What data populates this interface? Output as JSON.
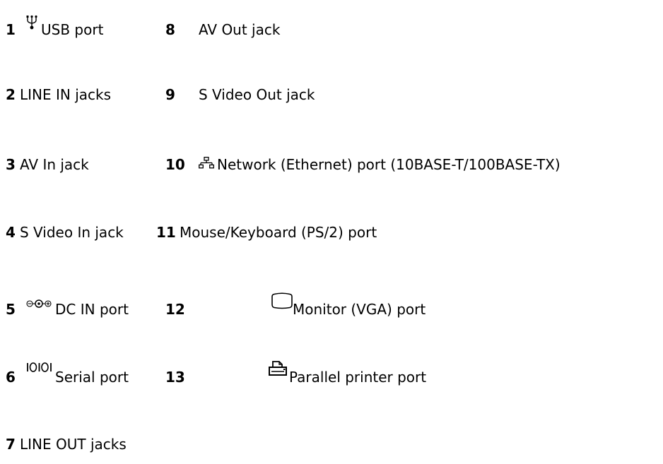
{
  "left_column": [
    {
      "num": "1",
      "label": "USB port",
      "icon": "usb-icon"
    },
    {
      "num": "2",
      "label": "LINE IN jacks",
      "icon": ""
    },
    {
      "num": "3",
      "label": "AV In jack",
      "icon": ""
    },
    {
      "num": "4",
      "label": "S Video In jack",
      "icon": ""
    },
    {
      "num": "5",
      "label": "DC IN port",
      "icon": "dc-in-icon"
    },
    {
      "num": "6",
      "label": "Serial port",
      "icon": "serial-port-icon"
    },
    {
      "num": "7",
      "label": "LINE OUT jacks",
      "icon": ""
    }
  ],
  "right_column": [
    {
      "num": "8",
      "label": "AV Out jack",
      "icon": ""
    },
    {
      "num": "9",
      "label": "S Video Out jack",
      "icon": ""
    },
    {
      "num": "10",
      "label": "Network (Ethernet) port (10BASE-T/100BASE-TX)",
      "icon": "network-icon"
    },
    {
      "num": "11",
      "label": "Mouse/Keyboard (PS/2) port",
      "icon": ""
    },
    {
      "num": "12",
      "label": "Monitor (VGA) port",
      "icon": "monitor-icon"
    },
    {
      "num": "13",
      "label": "Parallel printer port",
      "icon": "printer-icon"
    }
  ]
}
